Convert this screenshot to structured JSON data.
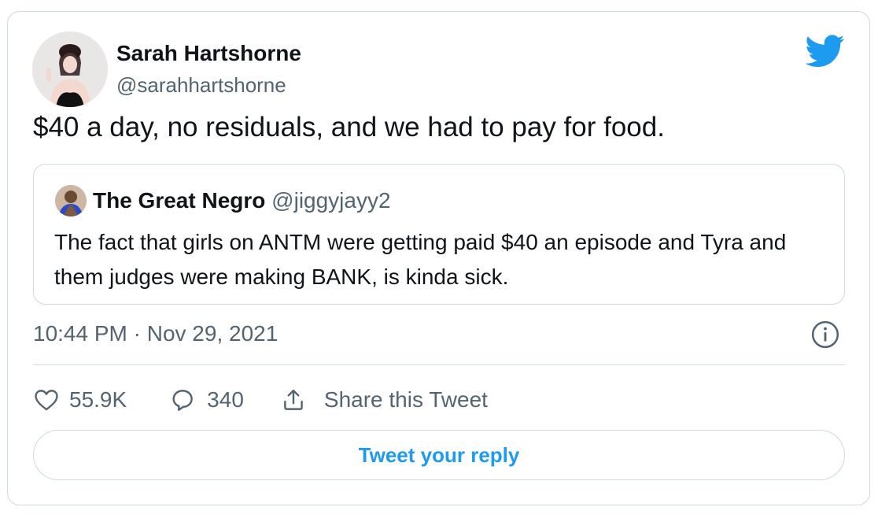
{
  "tweet": {
    "author_name": "Sarah Hartshorne",
    "author_handle": "@sarahhartshorne",
    "text": "$40 a day, no residuals, and we had to pay for food.",
    "timestamp": "10:44 PM · Nov 29, 2021",
    "likes": "55.9K",
    "replies": "340",
    "share_label": "Share this Tweet",
    "reply_button_label": "Tweet your reply"
  },
  "quoted_tweet": {
    "author_name": "The Great Negro",
    "author_handle": "@jiggyjayy2",
    "text": "The fact that girls on ANTM were getting paid $40 an episode and Tyra and them judges were making BANK, is kinda sick."
  },
  "icons": {
    "brand": "twitter-bird-icon",
    "info": "info-icon",
    "like": "heart-icon",
    "reply": "speech-bubble-icon",
    "share": "share-upload-icon"
  },
  "colors": {
    "accent": "#1d9bf0",
    "secondary_text": "#536471",
    "border": "#cfd9de",
    "primary_text": "#0f1419"
  }
}
